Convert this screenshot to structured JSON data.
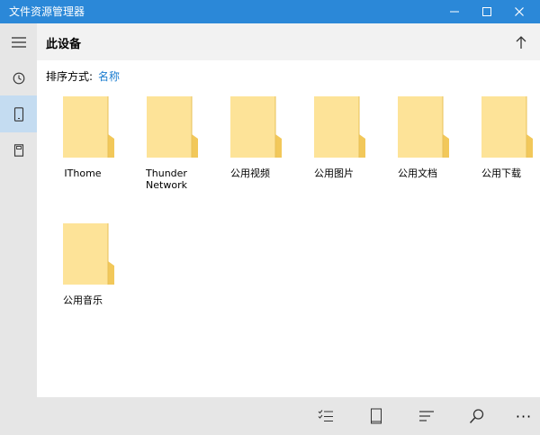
{
  "window": {
    "title": "文件资源管理器"
  },
  "header": {
    "title": "此设备"
  },
  "sort": {
    "label": "排序方式:",
    "value": "名称"
  },
  "folders": [
    {
      "name": "IThome"
    },
    {
      "name": "Thunder Network"
    },
    {
      "name": "公用视频"
    },
    {
      "name": "公用图片"
    },
    {
      "name": "公用文档"
    },
    {
      "name": "公用下载"
    },
    {
      "name": "公用音乐"
    }
  ],
  "commandbar": {
    "more_label": "···"
  },
  "icons": {
    "sidebar": [
      "menu-icon",
      "clock-icon",
      "phone-icon",
      "sd-card-icon"
    ],
    "commandbar": [
      "multi-select-icon",
      "view-icon",
      "sort-icon",
      "search-icon",
      "more-icon"
    ]
  },
  "colors": {
    "titlebar": "#2b88d8",
    "accent": "#1a7ccf",
    "folder": "#fde398",
    "selected": "#c4dcf1"
  }
}
